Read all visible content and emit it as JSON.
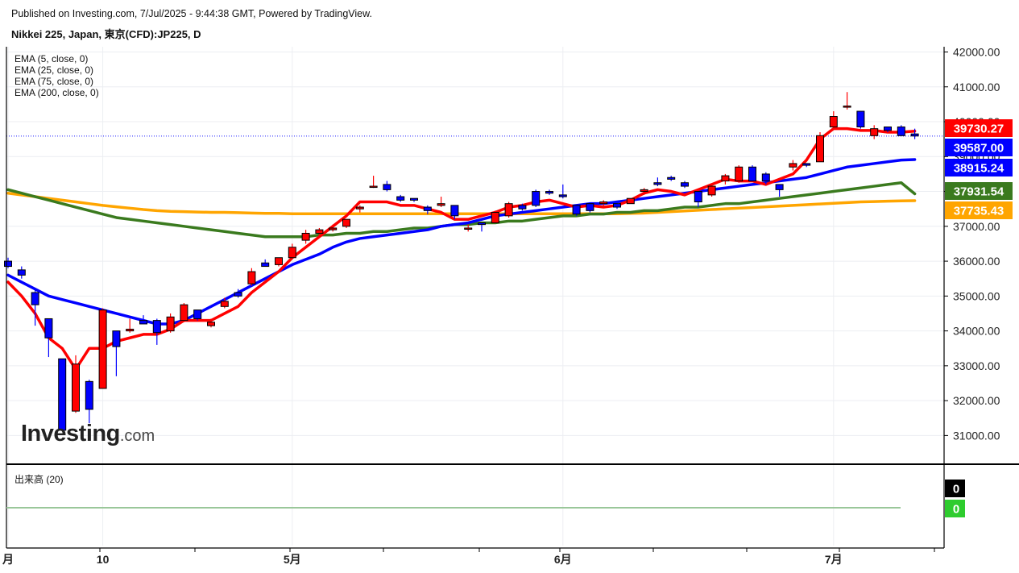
{
  "header": {
    "published": "Published on Investing.com, 7/Jul/2025 - 9:44:38 GMT, Powered by TradingView.",
    "symbol": "Nikkei 225, Japan, 東京(CFD):JP225, D"
  },
  "legend": [
    "EMA (5, close, 0)",
    "EMA (25, close, 0)",
    "EMA (75, close, 0)",
    "EMA (200, close, 0)"
  ],
  "volume_title": "出来高 (20)",
  "logo": {
    "main": "Investing",
    "suffix": ".com"
  },
  "colors": {
    "up": "#ff0000",
    "down": "#0000ff",
    "ema5": "#ff0000",
    "ema25": "#0000ff",
    "ema75": "#3a7a1e",
    "ema200": "#ffa500",
    "volume_badge_1": "#000000",
    "volume_badge_2": "#2ecc2e"
  },
  "chart_data": {
    "type": "candlestick",
    "ylim": [
      30200,
      42150
    ],
    "y_ticks": [
      "42000.00",
      "41000.00",
      "40000.00",
      "39000.00",
      "38000.00",
      "37000.00",
      "36000.00",
      "35000.00",
      "34000.00",
      "33000.00",
      "32000.00",
      "31000.00"
    ],
    "x_labels": [
      {
        "label": "月",
        "index": 0
      },
      {
        "label": "10",
        "index": 7
      },
      {
        "label": "5月",
        "index": 21
      },
      {
        "label": "6月",
        "index": 41
      },
      {
        "label": "7月",
        "index": 61
      }
    ],
    "grid": true,
    "current_price_line": 39587,
    "price_labels": [
      {
        "value": "39730.27",
        "series": "ema5"
      },
      {
        "value": "39587.00",
        "series": "last"
      },
      {
        "value": "38915.24",
        "series": "ema25"
      },
      {
        "value": "37931.54",
        "series": "ema75"
      },
      {
        "value": "37735.43",
        "series": "ema200"
      }
    ],
    "candles": [
      [
        36000,
        36100,
        35800,
        35850
      ],
      [
        35750,
        35850,
        35500,
        35600
      ],
      [
        35100,
        35200,
        34150,
        34750
      ],
      [
        34350,
        34350,
        33250,
        33800
      ],
      [
        33200,
        33200,
        31150,
        31150
      ],
      [
        31700,
        33300,
        31650,
        33050
      ],
      [
        32550,
        32600,
        31350,
        31750
      ],
      [
        32350,
        34650,
        32350,
        34600
      ],
      [
        34000,
        34000,
        32700,
        33550
      ],
      [
        34000,
        34350,
        33950,
        34050
      ],
      [
        34300,
        34450,
        34200,
        34200
      ],
      [
        34300,
        34350,
        33600,
        33950
      ],
      [
        34000,
        34500,
        33950,
        34400
      ],
      [
        34300,
        34800,
        34250,
        34750
      ],
      [
        34600,
        34600,
        34300,
        34350
      ],
      [
        34150,
        34350,
        34100,
        34250
      ],
      [
        34700,
        34950,
        34650,
        34850
      ],
      [
        35100,
        35200,
        34950,
        35000
      ],
      [
        35350,
        35800,
        35300,
        35700
      ],
      [
        35950,
        36050,
        35850,
        35850
      ],
      [
        35900,
        36100,
        35850,
        36100
      ],
      [
        36100,
        36500,
        36050,
        36400
      ],
      [
        36600,
        36900,
        36500,
        36800
      ],
      [
        36800,
        36950,
        36750,
        36900
      ],
      [
        36900,
        37050,
        36850,
        36950
      ],
      [
        37000,
        37200,
        36950,
        37200
      ],
      [
        37500,
        37600,
        37400,
        37550
      ],
      [
        38150,
        38450,
        38100,
        38150
      ],
      [
        38200,
        38300,
        38000,
        38050
      ],
      [
        37850,
        37900,
        37700,
        37750
      ],
      [
        37800,
        37800,
        37700,
        37750
      ],
      [
        37550,
        37600,
        37350,
        37450
      ],
      [
        37600,
        37850,
        37550,
        37650
      ],
      [
        37600,
        37600,
        37200,
        37300
      ],
      [
        36950,
        37050,
        36850,
        36950
      ],
      [
        37100,
        37100,
        36850,
        37050
      ],
      [
        37100,
        37450,
        37100,
        37400
      ],
      [
        37300,
        37700,
        37250,
        37650
      ],
      [
        37600,
        37650,
        37450,
        37500
      ],
      [
        38000,
        38050,
        37550,
        37600
      ],
      [
        38000,
        38050,
        37900,
        37950
      ],
      [
        37900,
        38200,
        37800,
        37850
      ],
      [
        37600,
        37600,
        37300,
        37350
      ],
      [
        37650,
        37650,
        37400,
        37450
      ],
      [
        37650,
        37750,
        37550,
        37700
      ],
      [
        37650,
        37700,
        37500,
        37550
      ],
      [
        37650,
        37800,
        37650,
        37800
      ],
      [
        38000,
        38100,
        37900,
        38050
      ],
      [
        38250,
        38400,
        38150,
        38200
      ],
      [
        38400,
        38450,
        38300,
        38350
      ],
      [
        38250,
        38300,
        38100,
        38150
      ],
      [
        38000,
        38000,
        37550,
        37700
      ],
      [
        37900,
        38200,
        37850,
        38150
      ],
      [
        38300,
        38500,
        38200,
        38450
      ],
      [
        38300,
        38750,
        38250,
        38700
      ],
      [
        38700,
        38750,
        38300,
        38300
      ],
      [
        38500,
        38550,
        38200,
        38300
      ],
      [
        38200,
        38200,
        37850,
        38050
      ],
      [
        38700,
        38900,
        38600,
        38800
      ],
      [
        38800,
        38800,
        38700,
        38750
      ],
      [
        38850,
        39700,
        38850,
        39600
      ],
      [
        39850,
        40300,
        39850,
        40150
      ],
      [
        40450,
        40850,
        40350,
        40450
      ],
      [
        40300,
        40300,
        39800,
        39850
      ],
      [
        39600,
        39900,
        39500,
        39800
      ],
      [
        39850,
        39850,
        39700,
        39750
      ],
      [
        39850,
        39900,
        39600,
        39600
      ],
      [
        39650,
        39800,
        39500,
        39590
      ]
    ],
    "ema5": [
      35400,
      35000,
      34500,
      33800,
      33500,
      32900,
      33500,
      33500,
      33700,
      33800,
      33900,
      33900,
      34050,
      34300,
      34300,
      34300,
      34500,
      34700,
      35100,
      35400,
      35700,
      36100,
      36400,
      36700,
      37000,
      37300,
      37700,
      37700,
      37700,
      37600,
      37600,
      37500,
      37400,
      37200,
      37200,
      37300,
      37400,
      37550,
      37600,
      37700,
      37750,
      37650,
      37550,
      37600,
      37550,
      37600,
      37750,
      37950,
      38050,
      38000,
      37900,
      38050,
      38200,
      38350,
      38300,
      38300,
      38200,
      38350,
      38500,
      38900,
      39500,
      39800,
      39800,
      39750,
      39750,
      39700,
      39700,
      39730
    ],
    "ema25": [
      35600,
      35400,
      35200,
      35000,
      34900,
      34800,
      34700,
      34600,
      34500,
      34400,
      34300,
      34200,
      34200,
      34300,
      34500,
      34700,
      34900,
      35100,
      35300,
      35500,
      35700,
      35900,
      36050,
      36200,
      36400,
      36550,
      36650,
      36700,
      36750,
      36800,
      36850,
      36900,
      37000,
      37050,
      37100,
      37200,
      37300,
      37350,
      37400,
      37450,
      37500,
      37550,
      37600,
      37650,
      37650,
      37700,
      37750,
      37800,
      37850,
      37900,
      37950,
      38000,
      38050,
      38100,
      38150,
      38200,
      38250,
      38300,
      38350,
      38400,
      38500,
      38600,
      38700,
      38750,
      38800,
      38850,
      38900,
      38915
    ],
    "ema75": [
      38050,
      37950,
      37850,
      37750,
      37650,
      37550,
      37450,
      37350,
      37250,
      37200,
      37150,
      37100,
      37050,
      37000,
      36950,
      36900,
      36850,
      36800,
      36750,
      36700,
      36700,
      36700,
      36700,
      36750,
      36750,
      36800,
      36800,
      36850,
      36850,
      36900,
      36950,
      36950,
      37000,
      37050,
      37050,
      37100,
      37100,
      37150,
      37150,
      37200,
      37250,
      37300,
      37300,
      37350,
      37350,
      37400,
      37400,
      37450,
      37450,
      37500,
      37550,
      37550,
      37600,
      37650,
      37650,
      37700,
      37750,
      37800,
      37850,
      37900,
      37950,
      38000,
      38050,
      38100,
      38150,
      38200,
      38250,
      37931
    ],
    "ema200": [
      37950,
      37900,
      37850,
      37800,
      37750,
      37700,
      37650,
      37600,
      37560,
      37520,
      37480,
      37450,
      37430,
      37420,
      37410,
      37400,
      37400,
      37390,
      37380,
      37370,
      37370,
      37360,
      37360,
      37360,
      37360,
      37360,
      37360,
      37360,
      37360,
      37360,
      37360,
      37360,
      37360,
      37360,
      37360,
      37360,
      37360,
      37360,
      37360,
      37360,
      37360,
      37360,
      37360,
      37360,
      37360,
      37360,
      37370,
      37380,
      37400,
      37420,
      37440,
      37460,
      37480,
      37500,
      37520,
      37540,
      37560,
      37580,
      37600,
      37620,
      37640,
      37660,
      37680,
      37700,
      37710,
      37720,
      37730,
      37735
    ],
    "volume": {
      "ylim": [
        0,
        1
      ],
      "badges": [
        "0",
        "0"
      ]
    }
  }
}
